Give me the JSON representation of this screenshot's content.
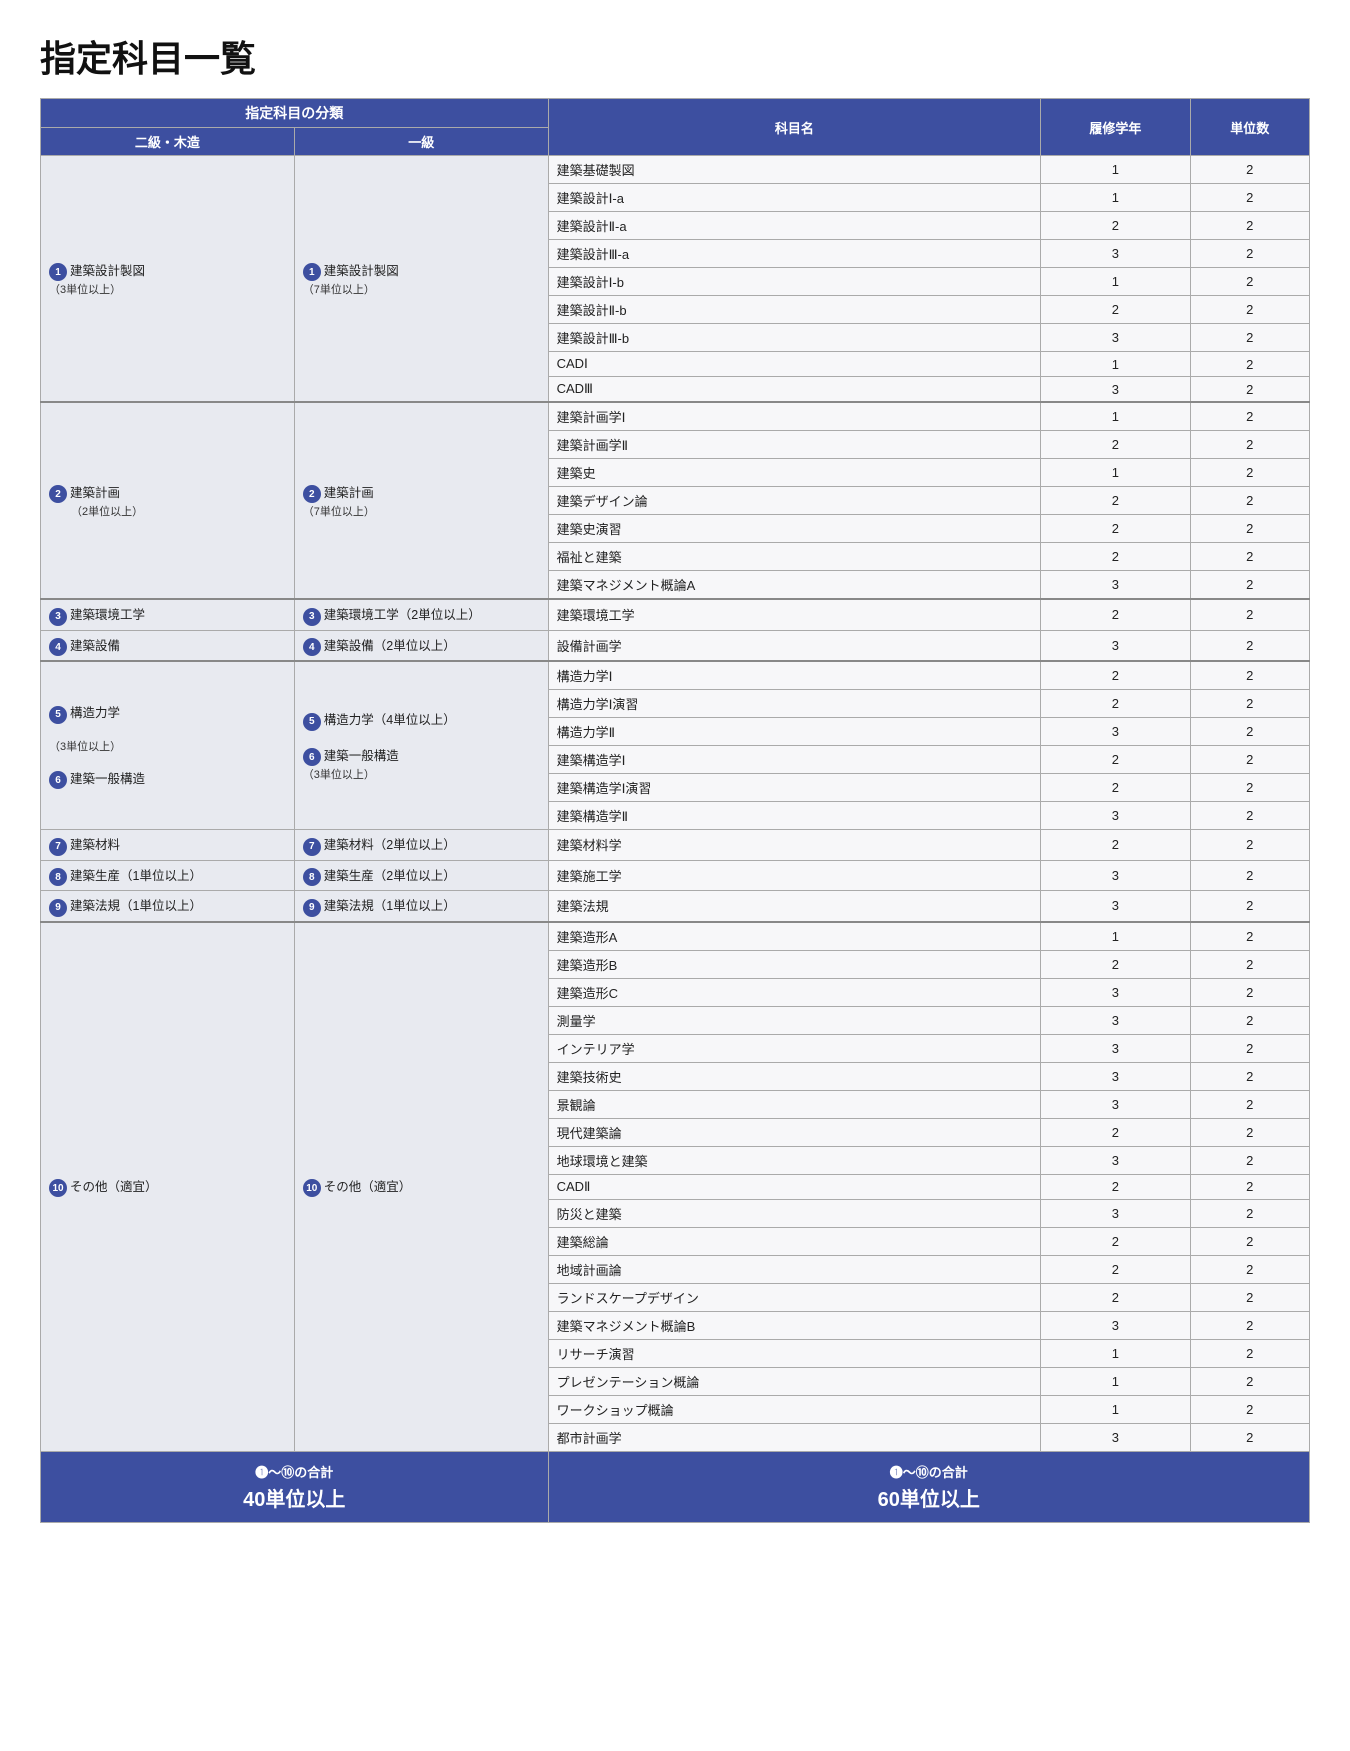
{
  "title": "指定科目一覧",
  "table": {
    "header_top": "指定科目の分類",
    "col_nikyu": "二級・木造",
    "col_ikkyu": "一級",
    "col_subject": "科目名",
    "col_year": "履修学年",
    "col_credits": "単位数"
  },
  "footer": {
    "nikyu_label": "❶～⑩の合計",
    "nikyu_value": "40単位以上",
    "ikkyu_label": "❶～⑩の合計",
    "ikkyu_value": "60単位以上"
  },
  "sections": [
    {
      "id": "1",
      "nikyu": "❶建築設計製図",
      "nikyu_note": "（3単位以上）",
      "ikkyu": "❶建築設計製図",
      "ikkyu_note": "（7単位以上）",
      "subjects": [
        {
          "name": "建築基礎製図",
          "year": "1",
          "credits": "2"
        },
        {
          "name": "建築設計Ⅰ-a",
          "year": "1",
          "credits": "2"
        },
        {
          "name": "建築設計Ⅱ-a",
          "year": "2",
          "credits": "2"
        },
        {
          "name": "建築設計Ⅲ-a",
          "year": "3",
          "credits": "2"
        },
        {
          "name": "建築設計Ⅰ-b",
          "year": "1",
          "credits": "2"
        },
        {
          "name": "建築設計Ⅱ-b",
          "year": "2",
          "credits": "2"
        },
        {
          "name": "建築設計Ⅲ-b",
          "year": "3",
          "credits": "2"
        },
        {
          "name": "CADⅠ",
          "year": "1",
          "credits": "2"
        },
        {
          "name": "CADⅢ",
          "year": "3",
          "credits": "2"
        }
      ]
    },
    {
      "id": "2_plan",
      "nikyu": "❷建築計画",
      "nikyu_note": "",
      "nikyu_span_note": "（2単位以上）",
      "ikkyu": "❷建築計画",
      "ikkyu_note": "（7単位以上）",
      "subjects": [
        {
          "name": "建築計画学Ⅰ",
          "year": "1",
          "credits": "2"
        },
        {
          "name": "建築計画学Ⅱ",
          "year": "2",
          "credits": "2"
        },
        {
          "name": "建築史",
          "year": "1",
          "credits": "2"
        },
        {
          "name": "建築デザイン論",
          "year": "2",
          "credits": "2"
        },
        {
          "name": "建築史演習",
          "year": "2",
          "credits": "2"
        },
        {
          "name": "福祉と建築",
          "year": "2",
          "credits": "2"
        },
        {
          "name": "建築マネジメント概論A",
          "year": "3",
          "credits": "2"
        }
      ]
    },
    {
      "id": "3",
      "nikyu": "❸建築環境工学",
      "nikyu_note": "",
      "ikkyu": "❸建築環境工学（2単位以上）",
      "ikkyu_note": "",
      "subjects": [
        {
          "name": "建築環境工学",
          "year": "2",
          "credits": "2"
        }
      ]
    },
    {
      "id": "4",
      "nikyu": "❹建築設備",
      "nikyu_note": "",
      "ikkyu": "❹建築設備（2単位以上）",
      "ikkyu_note": "",
      "subjects": [
        {
          "name": "設備計画学",
          "year": "3",
          "credits": "2"
        }
      ]
    },
    {
      "id": "5_6_7_8_9",
      "subjects_group1": [
        {
          "name": "構造力学Ⅰ",
          "year": "2",
          "credits": "2"
        },
        {
          "name": "構造力学Ⅰ演習",
          "year": "2",
          "credits": "2"
        },
        {
          "name": "構造力学Ⅱ",
          "year": "3",
          "credits": "2"
        },
        {
          "name": "建築構造学Ⅰ",
          "year": "2",
          "credits": "2"
        },
        {
          "name": "建築構造学Ⅰ演習",
          "year": "2",
          "credits": "2"
        },
        {
          "name": "建築構造学Ⅱ",
          "year": "3",
          "credits": "2"
        }
      ],
      "subjects_group2": [
        {
          "name": "建築材料学",
          "year": "2",
          "credits": "2"
        }
      ],
      "subjects_group3": [
        {
          "name": "建築施工学",
          "year": "3",
          "credits": "2"
        }
      ],
      "subjects_group4": [
        {
          "name": "建築法規",
          "year": "3",
          "credits": "2"
        }
      ]
    },
    {
      "id": "10",
      "nikyu": "⑩その他（適宜）",
      "ikkyu": "⑩その他（適宜）",
      "subjects": [
        {
          "name": "建築造形A",
          "year": "1",
          "credits": "2"
        },
        {
          "name": "建築造形B",
          "year": "2",
          "credits": "2"
        },
        {
          "name": "建築造形C",
          "year": "3",
          "credits": "2"
        },
        {
          "name": "測量学",
          "year": "3",
          "credits": "2"
        },
        {
          "name": "インテリア学",
          "year": "3",
          "credits": "2"
        },
        {
          "name": "建築技術史",
          "year": "3",
          "credits": "2"
        },
        {
          "name": "景観論",
          "year": "3",
          "credits": "2"
        },
        {
          "name": "現代建築論",
          "year": "2",
          "credits": "2"
        },
        {
          "name": "地球環境と建築",
          "year": "3",
          "credits": "2"
        },
        {
          "name": "CADⅡ",
          "year": "2",
          "credits": "2"
        },
        {
          "name": "防災と建築",
          "year": "3",
          "credits": "2"
        },
        {
          "name": "建築総論",
          "year": "2",
          "credits": "2"
        },
        {
          "name": "地域計画論",
          "year": "2",
          "credits": "2"
        },
        {
          "name": "ランドスケープデザイン",
          "year": "2",
          "credits": "2"
        },
        {
          "name": "建築マネジメント概論B",
          "year": "3",
          "credits": "2"
        },
        {
          "name": "リサーチ演習",
          "year": "1",
          "credits": "2"
        },
        {
          "name": "プレゼンテーション概論",
          "year": "1",
          "credits": "2"
        },
        {
          "name": "ワークショップ概論",
          "year": "1",
          "credits": "2"
        },
        {
          "name": "都市計画学",
          "year": "3",
          "credits": "2"
        }
      ]
    }
  ]
}
